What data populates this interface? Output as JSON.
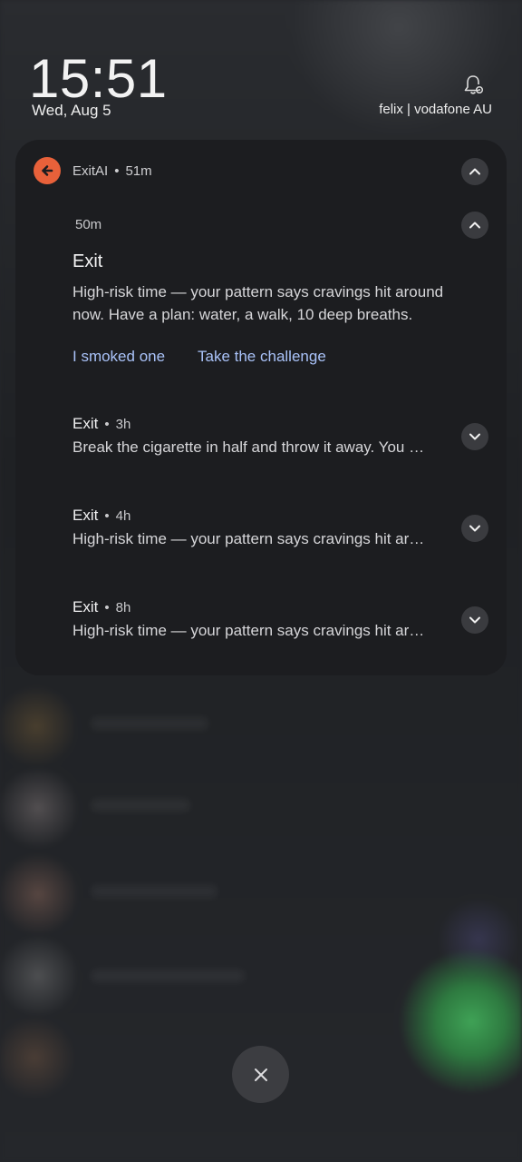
{
  "lockscreen": {
    "time": "15:51",
    "date": "Wed, Aug 5",
    "carrier": "felix | vodafone AU"
  },
  "notification_group": {
    "app_name": "ExitAI",
    "app_age": "51m",
    "accent_color": "#e8613a",
    "expanded": {
      "age": "50m",
      "title": "Exit",
      "body": "High-risk time — your pattern says cravings hit around now. Have a plan: water, a walk, 10 deep breaths.",
      "actions": [
        "I smoked one",
        "Take the challenge"
      ]
    },
    "items": [
      {
        "title": "Exit",
        "age": "3h",
        "body": "Break the cigarette in half and throw it away. You …"
      },
      {
        "title": "Exit",
        "age": "4h",
        "body": "High-risk time — your pattern says cravings hit ar…"
      },
      {
        "title": "Exit",
        "age": "8h",
        "body": "High-risk time — your pattern says cravings hit ar…"
      }
    ]
  },
  "icons": {
    "bell": "bell-settings-icon",
    "app": "arrow-left-icon",
    "collapse": "chevron-up-icon",
    "expand": "chevron-down-icon",
    "dismiss": "close-icon"
  }
}
